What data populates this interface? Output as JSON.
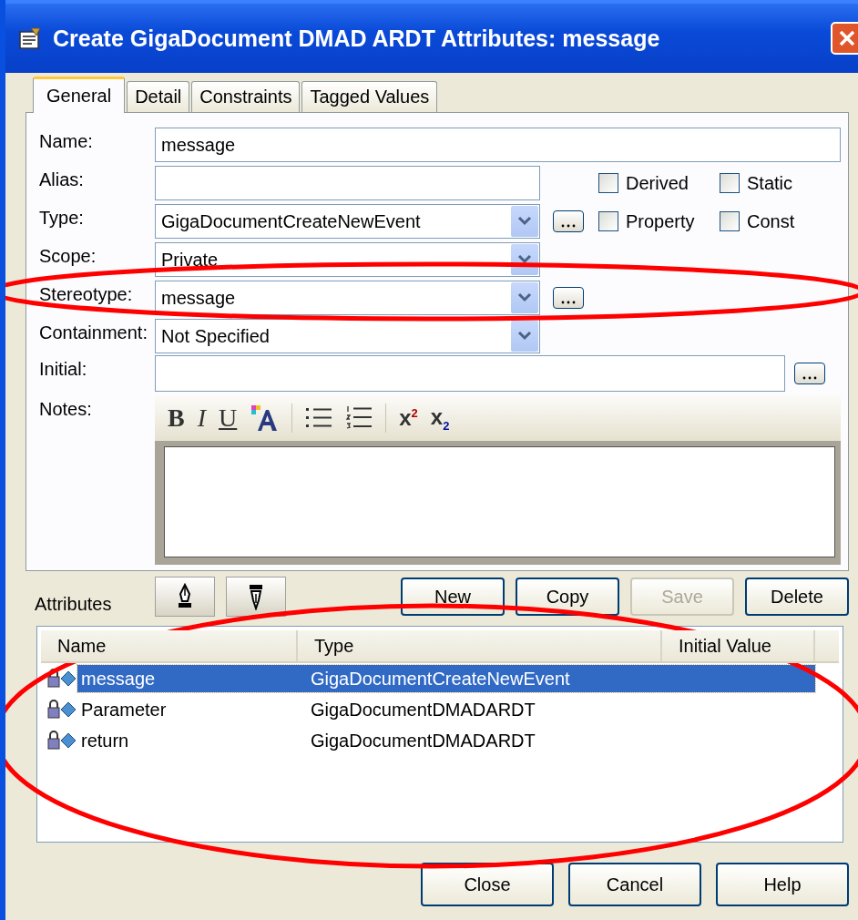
{
  "window": {
    "title": "Create GigaDocument DMAD ARDT Attributes: message"
  },
  "tabs": [
    {
      "label": "General",
      "selected": true
    },
    {
      "label": "Detail",
      "selected": false
    },
    {
      "label": "Constraints",
      "selected": false
    },
    {
      "label": "Tagged Values",
      "selected": false
    }
  ],
  "name": {
    "label": "Name:",
    "value": "message"
  },
  "alias": {
    "label": "Alias:"
  },
  "type": {
    "label": "Type:",
    "value": "GigaDocumentCreateNewEvent"
  },
  "scope": {
    "label": "Scope:",
    "value": "Private"
  },
  "stereotype": {
    "label": "Stereotype:",
    "value": "message"
  },
  "containment": {
    "label": "Containment:",
    "value": "Not Specified"
  },
  "initial": {
    "label": "Initial:"
  },
  "checkboxes": [
    {
      "label": "Derived",
      "checked": false
    },
    {
      "label": "Static",
      "checked": false
    },
    {
      "label": "Property",
      "checked": false
    },
    {
      "label": "Const",
      "checked": false
    }
  ],
  "notes": {
    "label": "Notes:",
    "toolbar": [
      {
        "kind": "bold",
        "text": "B"
      },
      {
        "kind": "italic",
        "text": "I"
      },
      {
        "kind": "underline",
        "text": "U"
      },
      {
        "kind": "font-color"
      },
      {
        "kind": "separator"
      },
      {
        "kind": "bullets"
      },
      {
        "kind": "numbering"
      },
      {
        "kind": "separator"
      },
      {
        "kind": "superscript",
        "text": "x",
        "mark": "2"
      },
      {
        "kind": "subscript",
        "text": "x",
        "mark": "2"
      }
    ]
  },
  "attributes": {
    "label": "Attributes",
    "buttons": [
      {
        "label": "New",
        "disabled": false
      },
      {
        "label": "Copy",
        "disabled": false
      },
      {
        "label": "Save",
        "disabled": true
      },
      {
        "label": "Delete",
        "disabled": false
      }
    ]
  },
  "list": {
    "columns": [
      "Name",
      "Type",
      "Initial Value"
    ],
    "rows": [
      {
        "name": "message",
        "type": "GigaDocumentCreateNewEvent",
        "selected": true
      },
      {
        "name": "Parameter",
        "type": "GigaDocumentDMADARDT",
        "selected": false
      },
      {
        "name": "return",
        "type": "GigaDocumentDMADARDT",
        "selected": false
      }
    ]
  },
  "footer_buttons": [
    "Close",
    "Cancel",
    "Help"
  ],
  "annotations": [
    {
      "kind": "ellipse"
    },
    {
      "kind": "ellipse"
    }
  ]
}
